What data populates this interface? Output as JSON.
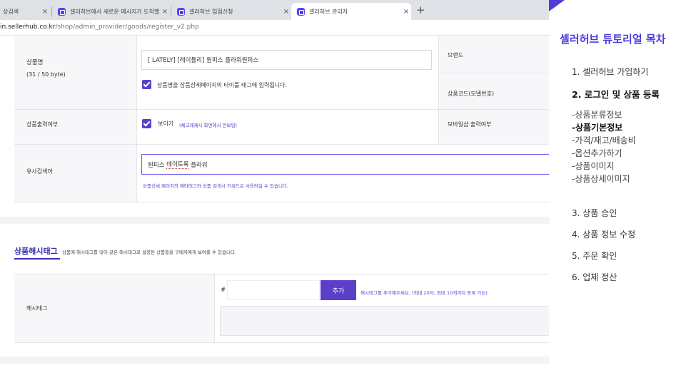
{
  "browser": {
    "tabs": [
      {
        "label": "상검색",
        "favicon": false
      },
      {
        "label": "셀러허브에서 새로운 메시지가 도착했",
        "favicon": true
      },
      {
        "label": "셀러허브 입점신청",
        "favicon": true
      },
      {
        "label": "셀러허브 관리자",
        "favicon": true
      }
    ],
    "close_glyph": "×",
    "new_tab_glyph": "+",
    "url_host": "in.sellerhub.co.kr",
    "url_path": "/shop/admin_provider/goods/register_v2.php"
  },
  "form": {
    "product_name": {
      "label": "상품명",
      "counter": "(31 / 50 byte)",
      "value": "[ LATELY] [레이틀리] 원피스 플라워원피스",
      "checkbox_label": "상품명을 상품상세페이지의 타이틀 태그에 입력됩니다."
    },
    "brand_label": "브랜드",
    "model_code_label": "상품코드(모델번호)",
    "display": {
      "label": "상품출력여부",
      "checkbox_label": "보이기",
      "checkbox_hint": "(체크해제시 화면에서 안보임)"
    },
    "mobile_label": "모바일샵 출력여부",
    "similar_search": {
      "label": "유사검색어",
      "value_pre": "원피스 ",
      "value_highlight": "데이트룩",
      "value_post": " 플라워",
      "hint": "상품상세 페이지의 메타태그와 상품 검색시 키워드로 사용하실 수 있습니다."
    }
  },
  "hashtag": {
    "section_title": "상품해시태그",
    "section_desc": "상품에 해시태그를 넣어 같은 해시태그로 설정된 상품들을 구매자에게 보여줄 수 있습니다.",
    "row_label": "해시태그",
    "prefix": "#",
    "add_button": "추가",
    "hint": "해시태그를 추가해주세요. (최대 20자, 최대 10개까지 등록 가능)"
  },
  "panel": {
    "title": "셀러허브 튜토리얼 목차",
    "items": [
      {
        "label": "1. 셀러허브 가입하기",
        "bold": false
      },
      {
        "label": "2. 로그인 및 상품 등록",
        "bold": true
      },
      {
        "label": "3. 상품 승인",
        "bold": false
      },
      {
        "label": "4. 상품 정보 수정",
        "bold": false
      },
      {
        "label": "5. 주문 확인",
        "bold": false
      },
      {
        "label": "6. 업체 정산",
        "bold": false
      }
    ],
    "subitems": [
      {
        "label": "-상품분류정보",
        "bold": false
      },
      {
        "label": "-상품기본정보",
        "bold": true
      },
      {
        "label": "-가격/재고/배송비",
        "bold": false
      },
      {
        "label": "-옵션추가하기",
        "bold": false
      },
      {
        "label": "-상품이미지",
        "bold": false
      },
      {
        "label": "-상품상세이미지",
        "bold": false
      }
    ],
    "accent_color": "#4a3adf"
  }
}
